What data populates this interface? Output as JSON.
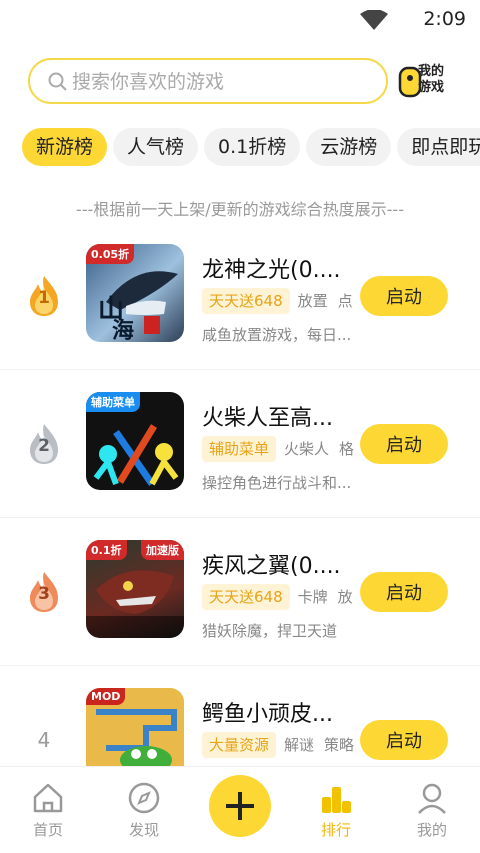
{
  "status_bar": {
    "time": "2:09"
  },
  "search": {
    "placeholder": "搜索你喜欢的游戏"
  },
  "my_games": {
    "label": "我的游戏"
  },
  "tabs": [
    {
      "label": "新游榜",
      "active": true
    },
    {
      "label": "人气榜"
    },
    {
      "label": "0.1折榜"
    },
    {
      "label": "云游榜"
    },
    {
      "label": "即点即玩"
    }
  ],
  "note": "---根据前一天上架/更新的游戏综合热度展示---",
  "games": [
    {
      "rank": "1",
      "title": "龙神之光(0....",
      "badge": "0.05折",
      "tag_hl": "天天送648",
      "tags": [
        "放置",
        "点"
      ],
      "desc": "咸鱼放置游戏，每日...",
      "button": "启动"
    },
    {
      "rank": "2",
      "title": "火柴人至高...",
      "badge": "辅助菜单",
      "tag_hl": "辅助菜单",
      "tags": [
        "火柴人",
        "格"
      ],
      "desc": "操控角色进行战斗和...",
      "button": "启动"
    },
    {
      "rank": "3",
      "title": "疾风之翼(0....",
      "badge": "0.1折",
      "badge2": "加速版",
      "tag_hl": "天天送648",
      "tags": [
        "卡牌",
        "放"
      ],
      "desc": "猎妖除魔，捍卫天道",
      "button": "启动"
    },
    {
      "rank": "4",
      "title": "鳄鱼小顽皮...",
      "badge": "MOD",
      "tag_hl": "大量资源",
      "tags": [
        "解谜",
        "策略"
      ],
      "desc": "",
      "button": "启动"
    }
  ],
  "bottom_nav": {
    "home": "首页",
    "discover": "发现",
    "rank": "排行",
    "mine": "我的"
  },
  "colors": {
    "accent": "#fdd835",
    "active_text": "#f2b705"
  }
}
